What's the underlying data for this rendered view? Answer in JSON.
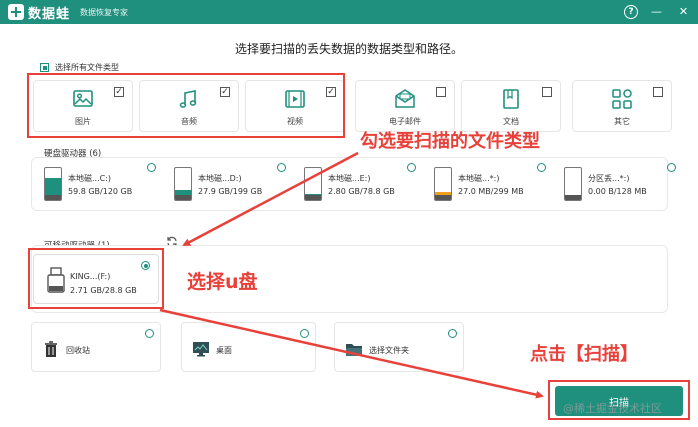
{
  "app": {
    "name": "数据蛙",
    "slogan": "数据恢复专家"
  },
  "titlebar": {
    "help_icon": "question-circle-icon",
    "minimize_glyph": "—",
    "close_glyph": "✕"
  },
  "headline": "选择要扫描的丢失数据的数据类型和路径。",
  "file_types": {
    "select_all_label": "选择所有文件类型",
    "items": [
      {
        "label": "图片",
        "icon": "image-icon",
        "checked": true
      },
      {
        "label": "音频",
        "icon": "music-note-icon",
        "checked": true
      },
      {
        "label": "视频",
        "icon": "video-icon",
        "checked": true
      },
      {
        "label": "电子邮件",
        "icon": "email-icon",
        "checked": false
      },
      {
        "label": "文档",
        "icon": "document-icon",
        "checked": false
      },
      {
        "label": "其它",
        "icon": "grid-icon",
        "checked": false
      }
    ]
  },
  "hdd": {
    "title": "硬盘驱动器 (6)",
    "drives": [
      {
        "name": "本地磁...C:)",
        "size": "59.8 GB/120 GB",
        "fill": 0.5
      },
      {
        "name": "本地磁...D:)",
        "size": "27.9 GB/199 GB",
        "fill": 0.14
      },
      {
        "name": "本地磁...E:)",
        "size": "2.80 GB/78.8 GB",
        "fill": 0.04
      },
      {
        "name": "本地磁...*:)",
        "size": "27.0 MB/299 MB",
        "fill": 0.09
      },
      {
        "name": "分区丢...*:)",
        "size": "0.00 B/128 MB",
        "fill": 0
      }
    ]
  },
  "removable": {
    "title": "可移动驱动器 (1)",
    "drive": {
      "name": "KING...(F:)",
      "size": "2.71 GB/28.8 GB",
      "selected": true
    }
  },
  "locations": [
    {
      "label": "回收站",
      "icon": "trash-icon"
    },
    {
      "label": "桌面",
      "icon": "desktop-icon"
    },
    {
      "label": "选择文件夹",
      "icon": "folder-icon"
    }
  ],
  "scan_button": "扫描",
  "annotations": {
    "select_types": "勾选要扫描的文件类型",
    "select_usb": "选择u盘",
    "click_scan": "点击【扫描】"
  },
  "watermark": "@稀土掘金技术社区",
  "colors": {
    "brand": "#1f8f7e",
    "annotation": "#e8413a"
  }
}
